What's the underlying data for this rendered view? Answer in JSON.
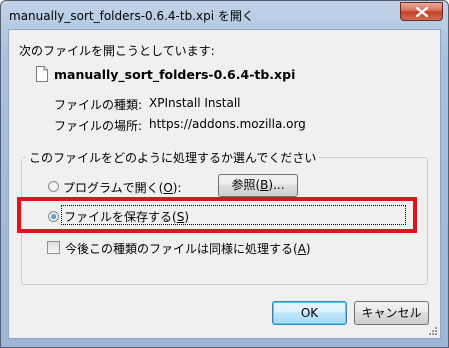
{
  "window": {
    "title": "manually_sort_folders-0.6.4-tb.xpi を開く"
  },
  "dialog": {
    "intro": "次のファイルを開こうとしています:",
    "filename": "manually_sort_folders-0.6.4-tb.xpi",
    "file_type_label": "ファイルの種類:",
    "file_type_value": "XPInstall Install",
    "file_location_label": "ファイルの場所:",
    "file_location_value": "https://addons.mozilla.org",
    "group_title": "このファイルをどのように処理するか選んでください",
    "options": {
      "open_with": {
        "label": "プログラムで開く(",
        "accel": "O",
        "suffix": "):",
        "checked": false
      },
      "browse_button": {
        "label": "参照(",
        "accel": "B",
        "suffix": ")..."
      },
      "save_file": {
        "label": "ファイルを保存する(",
        "accel": "S",
        "suffix": ")",
        "checked": true
      },
      "remember": {
        "label": "今後この種類のファイルは同様に処理する(",
        "accel": "A",
        "suffix": ")",
        "checked": false
      }
    },
    "ok_button": "OK",
    "cancel_button": "キャンセル"
  },
  "colors": {
    "highlight": "#e0141e",
    "close_button": "#c4412a"
  },
  "icons": [
    "close-icon",
    "file-icon",
    "resize-grip-icon"
  ]
}
